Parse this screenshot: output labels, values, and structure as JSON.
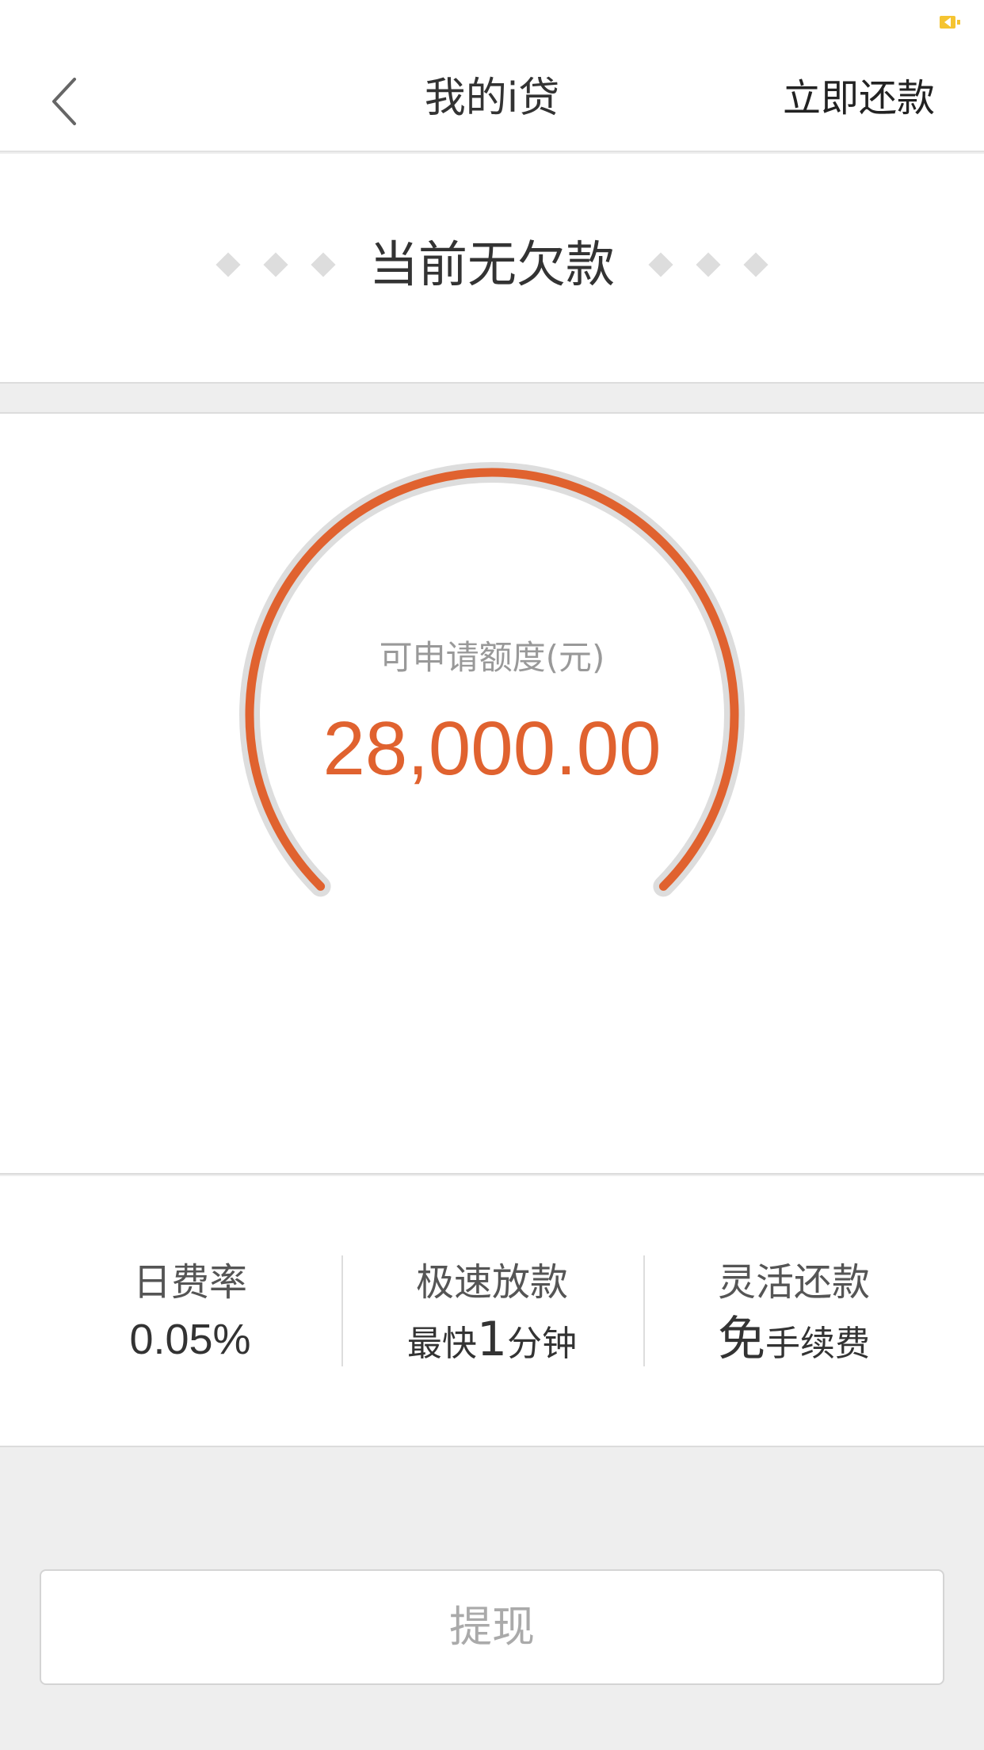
{
  "colors": {
    "accent": "#e0622f",
    "gauge_track": "#dddddd",
    "status_battery": "#f5c431"
  },
  "header": {
    "title": "我的i贷",
    "back_icon": "chevron-left-icon",
    "action_label": "立即还款"
  },
  "debt": {
    "status": "当前无欠款"
  },
  "quota": {
    "label": "可申请额度(元)",
    "value": "28,000.00"
  },
  "features": {
    "rate": {
      "title": "日费率",
      "value": "0.05%"
    },
    "speed": {
      "title": "极速放款",
      "prefix": "最快",
      "number": "1",
      "suffix": "分钟"
    },
    "repay": {
      "title": "灵活还款",
      "prefix": "免",
      "suffix": "手续费"
    }
  },
  "withdraw": {
    "label": "提现"
  }
}
